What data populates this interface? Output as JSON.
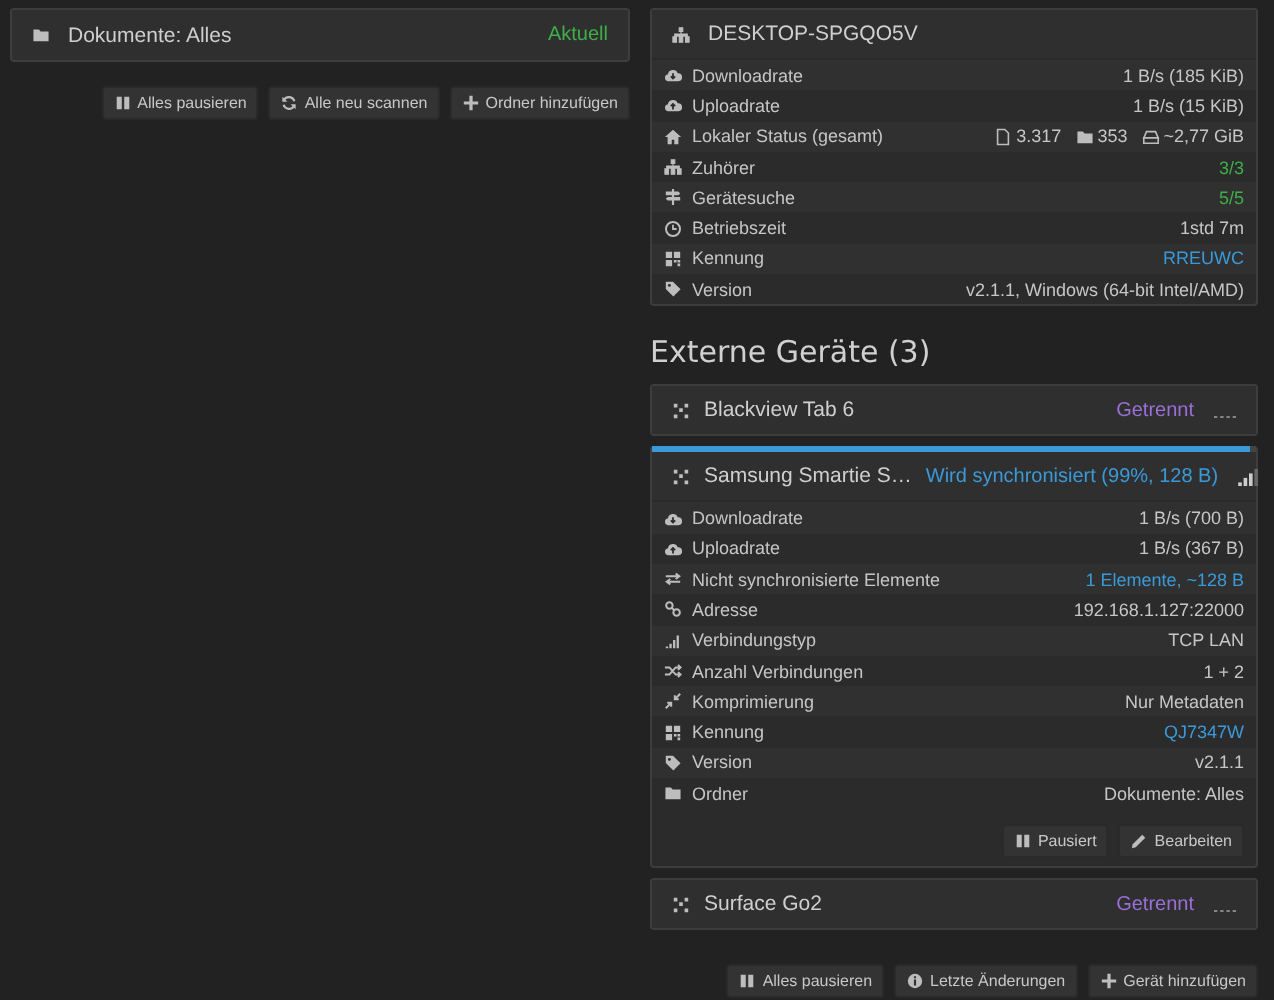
{
  "folders": [
    {
      "name": "Dokumente: Alles",
      "status": "Aktuell",
      "color": "#3fae49"
    }
  ],
  "folder_buttons": [
    "Alles pausieren",
    "Alle neu scannen",
    "Ordner hinzufügen"
  ],
  "this_device": {
    "name": "DESKTOP-SPGQO5V",
    "rows": [
      {
        "label": "Downloadrate",
        "value": "1 B/s (185 KiB)"
      },
      {
        "label": "Uploadrate",
        "value": "1 B/s (15 KiB)"
      },
      {
        "label": "Lokaler Status (gesamt)",
        "values": [
          "3.317",
          "353",
          "~2,77 GiB"
        ]
      },
      {
        "label": "Zuhörer",
        "value": "3/3",
        "color": "#3fae49"
      },
      {
        "label": "Gerätesuche",
        "value": "5/5",
        "color": "#3fae49"
      },
      {
        "label": "Betriebszeit",
        "value": "1std 7m"
      },
      {
        "label": "Kennung",
        "value": "RREUWC",
        "color": "#3a9ad9"
      },
      {
        "label": "Version",
        "value": "v2.1.1, Windows (64-bit Intel/AMD)"
      }
    ]
  },
  "remote_heading": "Externe Geräte (3)",
  "remote_devices": [
    {
      "name": "Blackview Tab 6",
      "status": "Getrennt",
      "color": "#9b6fd8",
      "connected": false,
      "expanded": false
    },
    {
      "name": "Samsung Smartie S…",
      "status": "Wird synchronisiert (99%, 128 B)",
      "color": "#3a9ad9",
      "connected": true,
      "expanded": true,
      "level": 0.99,
      "rows": [
        {
          "label": "Downloadrate",
          "value": "1 B/s (700 B)"
        },
        {
          "label": "Uploadrate",
          "value": "1 B/s (367 B)"
        },
        {
          "label": "Nicht synchronisierte Elemente",
          "value": "1 Elemente, ~128 B",
          "color": "#3a9ad9"
        },
        {
          "label": "Adresse",
          "value": "192.168.1.127:22000"
        },
        {
          "label": "Verbindungstyp",
          "value": "TCP LAN"
        },
        {
          "label": "Anzahl Verbindungen",
          "value": "1 + 2"
        },
        {
          "label": "Komprimierung",
          "value": "Nur Metadaten"
        },
        {
          "label": "Kennung",
          "value": "QJ7347W",
          "color": "#3a9ad9"
        },
        {
          "label": "Version",
          "value": "v2.1.1"
        },
        {
          "label": "Ordner",
          "value": "Dokumente: Alles"
        }
      ],
      "buttons": [
        "Pausiert",
        "Bearbeiten"
      ]
    },
    {
      "name": "Surface Go2",
      "status": "Getrennt",
      "color": "#9b6fd8",
      "connected": false,
      "expanded": false
    }
  ],
  "device_buttons": [
    "Alles pausieren",
    "Letzte Änderungen",
    "Gerät hinzufügen"
  ]
}
